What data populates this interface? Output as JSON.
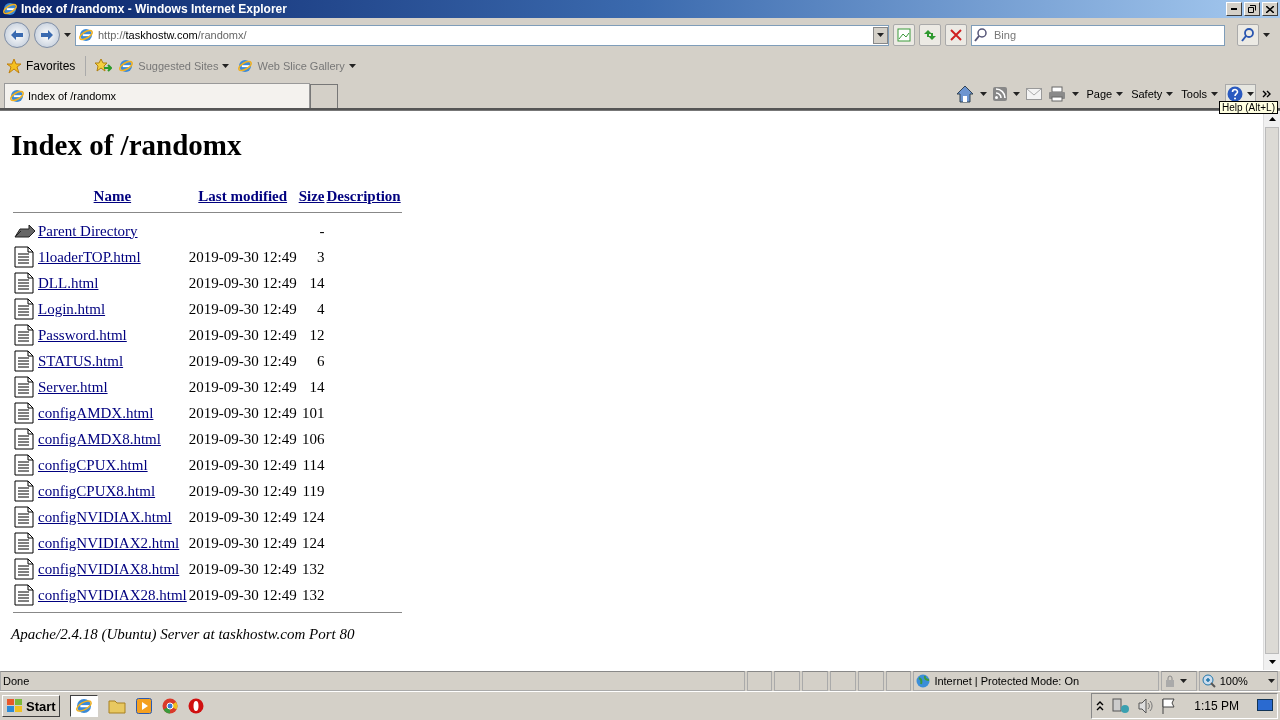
{
  "window": {
    "title": "Index of /randomx - Windows Internet Explorer"
  },
  "address_bar": {
    "url_scheme": "http://",
    "url_host": "taskhostw.com",
    "url_path": "/randomx/"
  },
  "search": {
    "placeholder": "Bing"
  },
  "favorites_bar": {
    "label": "Favorites",
    "links": [
      "Suggested Sites",
      "Web Slice Gallery"
    ]
  },
  "tabs": [
    {
      "label": "Index of /randomx",
      "selected": true
    }
  ],
  "command_bar": {
    "menus": [
      "Page",
      "Safety",
      "Tools"
    ],
    "tooltip": "Help (Alt+L)"
  },
  "page": {
    "heading": "Index of /randomx",
    "columns": [
      "Name",
      "Last modified",
      "Size",
      "Description"
    ],
    "rows": [
      {
        "kind": "parent",
        "name": "Parent Directory",
        "size": "-"
      },
      {
        "kind": "file",
        "name": "1loaderTOP.html",
        "modified": "2019-09-30 12:49",
        "size": "3"
      },
      {
        "kind": "file",
        "name": "DLL.html",
        "modified": "2019-09-30 12:49",
        "size": "14"
      },
      {
        "kind": "file",
        "name": "Login.html",
        "modified": "2019-09-30 12:49",
        "size": "4"
      },
      {
        "kind": "file",
        "name": "Password.html",
        "modified": "2019-09-30 12:49",
        "size": "12"
      },
      {
        "kind": "file",
        "name": "STATUS.html",
        "modified": "2019-09-30 12:49",
        "size": "6"
      },
      {
        "kind": "file",
        "name": "Server.html",
        "modified": "2019-09-30 12:49",
        "size": "14"
      },
      {
        "kind": "file",
        "name": "configAMDX.html",
        "modified": "2019-09-30 12:49",
        "size": "101"
      },
      {
        "kind": "file",
        "name": "configAMDX8.html",
        "modified": "2019-09-30 12:49",
        "size": "106"
      },
      {
        "kind": "file",
        "name": "configCPUX.html",
        "modified": "2019-09-30 12:49",
        "size": "114"
      },
      {
        "kind": "file",
        "name": "configCPUX8.html",
        "modified": "2019-09-30 12:49",
        "size": "119"
      },
      {
        "kind": "file",
        "name": "configNVIDIAX.html",
        "modified": "2019-09-30 12:49",
        "size": "124"
      },
      {
        "kind": "file",
        "name": "configNVIDIAX2.html",
        "modified": "2019-09-30 12:49",
        "size": "124"
      },
      {
        "kind": "file",
        "name": "configNVIDIAX8.html",
        "modified": "2019-09-30 12:49",
        "size": "132"
      },
      {
        "kind": "file",
        "name": "configNVIDIAX28.html",
        "modified": "2019-09-30 12:49",
        "size": "132"
      }
    ],
    "footer": "Apache/2.4.18 (Ubuntu) Server at taskhostw.com Port 80"
  },
  "status_bar": {
    "text": "Done",
    "zone": "Internet | Protected Mode: On",
    "zoom": "100%"
  },
  "taskbar": {
    "start": "Start",
    "clock": "1:15 PM"
  }
}
